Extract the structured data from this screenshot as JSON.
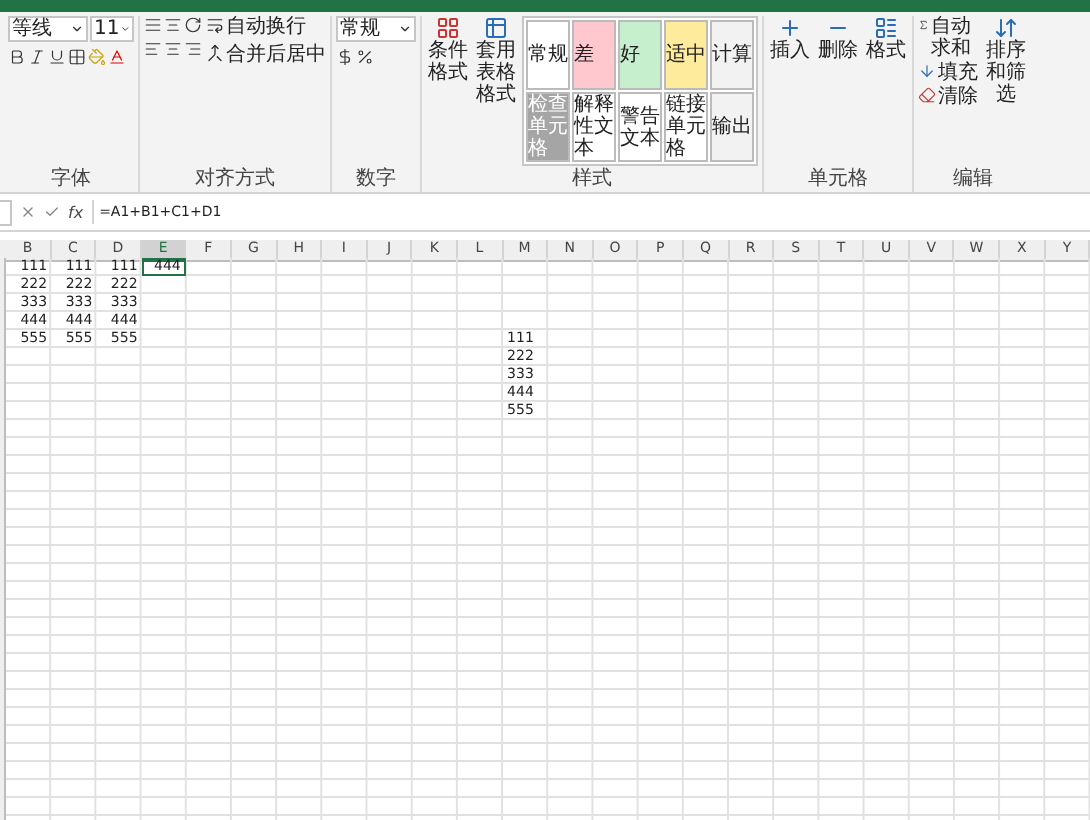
{
  "ribbon": {
    "font": {
      "label": "字体",
      "font_name": "等线",
      "font_size": "11"
    },
    "alignment": {
      "label": "对齐方式",
      "wrap_text": "自动换行",
      "merge_center": "合并后居中"
    },
    "number": {
      "label": "数字",
      "format": "常规"
    },
    "styles": {
      "label": "样式",
      "conditional_format": "条件格式",
      "table_format": "套用表格格式",
      "gallery": [
        {
          "label": "常规",
          "color": "#ffffff"
        },
        {
          "label": "差",
          "color": "#ffc7ce"
        },
        {
          "label": "好",
          "color": "#c6efce"
        },
        {
          "label": "适中",
          "color": "#ffeb9c"
        },
        {
          "label": "计算",
          "color": "#f2f2f2"
        },
        {
          "label": "检查单元格",
          "color": "#a5a5a5"
        },
        {
          "label": "解释性文本",
          "color": "#ffffff"
        },
        {
          "label": "警告文本",
          "color": "#ffffff"
        },
        {
          "label": "链接单元格",
          "color": "#ffffff"
        },
        {
          "label": "输出",
          "color": "#f2f2f2"
        }
      ]
    },
    "cells": {
      "label": "单元格",
      "buttons": [
        "插入",
        "删除",
        "格式"
      ]
    },
    "editing": {
      "label": "编辑",
      "autosum": "自动求和",
      "fill": "填充",
      "clear": "清除",
      "sort_filter": "排序和筛选"
    }
  },
  "formula_bar": {
    "fx": "fx",
    "formula": "=A1+B1+C1+D1"
  },
  "sheet": {
    "columns": [
      {
        "label": "B",
        "selected": false
      },
      {
        "label": "C",
        "selected": false
      },
      {
        "label": "D",
        "selected": false
      },
      {
        "label": "E",
        "selected": true
      },
      {
        "label": "F",
        "selected": false
      },
      {
        "label": "G",
        "selected": false
      },
      {
        "label": "H",
        "selected": false
      },
      {
        "label": "I",
        "selected": false
      },
      {
        "label": "J",
        "selected": false
      },
      {
        "label": "K",
        "selected": false
      },
      {
        "label": "L",
        "selected": false
      },
      {
        "label": "M",
        "selected": false
      },
      {
        "label": "N",
        "selected": false
      },
      {
        "label": "O",
        "selected": false
      },
      {
        "label": "P",
        "selected": false
      },
      {
        "label": "Q",
        "selected": false
      },
      {
        "label": "R",
        "selected": false
      },
      {
        "label": "S",
        "selected": false
      },
      {
        "label": "T",
        "selected": false
      },
      {
        "label": "U",
        "selected": false
      },
      {
        "label": "V",
        "selected": false
      },
      {
        "label": "W",
        "selected": false
      },
      {
        "label": "X",
        "selected": false
      },
      {
        "label": "Y",
        "selected": false
      }
    ],
    "rows": [
      {
        "cells": [
          {
            "value": "111",
            "kind": "number",
            "selected": false
          },
          {
            "value": "111",
            "kind": "number",
            "selected": false
          },
          {
            "value": "111",
            "kind": "number",
            "selected": false
          },
          {
            "value": "444",
            "kind": "number",
            "selected": true
          }
        ]
      },
      {
        "cells": [
          {
            "value": "222",
            "kind": "number",
            "selected": false
          },
          {
            "value": "222",
            "kind": "number",
            "selected": false
          },
          {
            "value": "222",
            "kind": "number",
            "selected": false
          }
        ]
      },
      {
        "cells": [
          {
            "value": "333",
            "kind": "number",
            "selected": false
          },
          {
            "value": "333",
            "kind": "number",
            "selected": false
          },
          {
            "value": "333",
            "kind": "number",
            "selected": false
          }
        ]
      },
      {
        "cells": [
          {
            "value": "444",
            "kind": "number",
            "selected": false
          },
          {
            "value": "444",
            "kind": "number",
            "selected": false
          },
          {
            "value": "444",
            "kind": "number",
            "selected": false
          }
        ]
      },
      {
        "cells": [
          {
            "value": "555",
            "kind": "number",
            "selected": false
          },
          {
            "value": "555",
            "kind": "number",
            "selected": false
          },
          {
            "value": "555",
            "kind": "number",
            "selected": false
          },
          null,
          null,
          null,
          null,
          null,
          null,
          null,
          null,
          {
            "value": "111",
            "kind": "text",
            "selected": false
          }
        ]
      },
      {
        "cells": [
          null,
          null,
          null,
          null,
          null,
          null,
          null,
          null,
          null,
          null,
          null,
          {
            "value": "222",
            "kind": "text",
            "selected": false
          }
        ]
      },
      {
        "cells": [
          null,
          null,
          null,
          null,
          null,
          null,
          null,
          null,
          null,
          null,
          null,
          {
            "value": "333",
            "kind": "text",
            "selected": false
          }
        ]
      },
      {
        "cells": [
          null,
          null,
          null,
          null,
          null,
          null,
          null,
          null,
          null,
          null,
          null,
          {
            "value": "444",
            "kind": "text",
            "selected": false
          }
        ]
      },
      {
        "cells": [
          null,
          null,
          null,
          null,
          null,
          null,
          null,
          null,
          null,
          null,
          null,
          {
            "value": "555",
            "kind": "text",
            "selected": false
          }
        ]
      }
    ]
  }
}
